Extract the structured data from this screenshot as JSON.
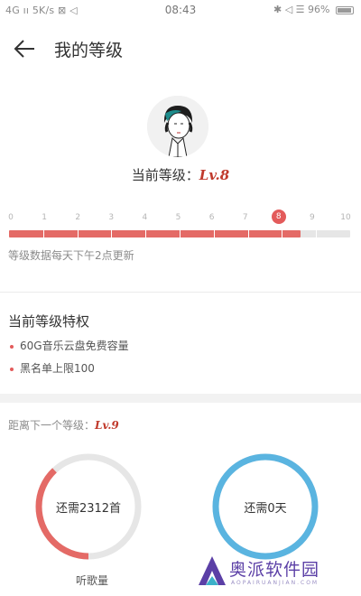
{
  "status_bar": {
    "left": "4G ıı  5K/s ⊠ ◁",
    "time": "08:43",
    "right": "✱ ◁ ☰ 96%"
  },
  "header": {
    "title": "我的等级"
  },
  "level": {
    "current_label": "当前等级：",
    "current_value": "Lv.8",
    "current_numeric": 8,
    "max_numeric": 10,
    "progress_fraction": 0.855,
    "ticks": [
      "0",
      "1",
      "2",
      "3",
      "4",
      "5",
      "6",
      "7",
      "8",
      "9",
      "10"
    ],
    "update_note": "等级数据每天下午2点更新"
  },
  "privileges": {
    "title": "当前等级特权",
    "items": [
      "60G音乐云盘免费容量",
      "黑名单上限100"
    ]
  },
  "next_level": {
    "label": "距离下一个等级：",
    "value": "Lv.9",
    "songs_remaining": "还需2312首",
    "songs_caption": "听歌量",
    "songs_progress_fraction": 0.38,
    "days_remaining": "还需0天",
    "days_progress_fraction": 1.0
  },
  "watermark": {
    "text": "奥派软件园",
    "sub": "AOPAIRUANJIAN.COM"
  },
  "colors": {
    "accent": "#e46a66",
    "accent_dark": "#e35b5b",
    "level_text": "#c0392b",
    "days_ring": "#5ab4e0",
    "track": "#e6e6e6"
  }
}
